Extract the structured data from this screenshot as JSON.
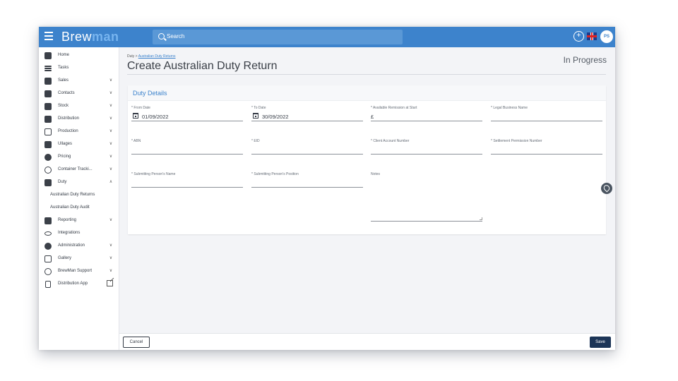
{
  "app": {
    "logo_part1": "Brew",
    "logo_part2": "man",
    "search_placeholder": "Search",
    "avatar_initials": "PS",
    "colors": {
      "topbar": "#3d83cc",
      "accent": "#3d83cc",
      "save": "#1c3557"
    }
  },
  "sidebar": {
    "items": [
      {
        "label": "Home",
        "icon": "home-icon"
      },
      {
        "label": "Tasks",
        "icon": "list-icon"
      },
      {
        "label": "Sales",
        "icon": "basket-icon",
        "chevron": "down"
      },
      {
        "label": "Contacts",
        "icon": "contacts-icon",
        "chevron": "down"
      },
      {
        "label": "Stock",
        "icon": "funnel-icon",
        "chevron": "down"
      },
      {
        "label": "Distribution",
        "icon": "truck-icon",
        "chevron": "down"
      },
      {
        "label": "Production",
        "icon": "production-icon",
        "chevron": "down"
      },
      {
        "label": "Ullages",
        "icon": "bottle-icon",
        "chevron": "down"
      },
      {
        "label": "Pricing",
        "icon": "pricing-icon",
        "chevron": "down"
      },
      {
        "label": "Container Tracki...",
        "icon": "target-icon",
        "chevron": "down"
      },
      {
        "label": "Duty",
        "icon": "duty-icon",
        "chevron": "up"
      },
      {
        "label": "Australian Duty Returns",
        "sub": true
      },
      {
        "label": "Australian Duty Audit",
        "sub": true
      },
      {
        "label": "Reporting",
        "icon": "report-icon",
        "chevron": "down"
      },
      {
        "label": "Integrations",
        "icon": "link-icon"
      },
      {
        "label": "Administration",
        "icon": "gear-icon",
        "chevron": "down"
      },
      {
        "label": "Gallery",
        "icon": "gallery-icon",
        "chevron": "down"
      },
      {
        "label": "BrewMan Support",
        "icon": "support-icon",
        "chevron": "down"
      },
      {
        "label": "Distribution App",
        "icon": "phone-icon",
        "external": true
      }
    ]
  },
  "main": {
    "breadcrumb_root": "Duty",
    "breadcrumb_sep": " > ",
    "breadcrumb_link": "Australian Duty Returns",
    "title": "Create Australian Duty Return",
    "status": "In Progress",
    "card_title": "Duty Details",
    "fields": {
      "from_date": {
        "label": "* From Date",
        "value": "01/09/2022"
      },
      "to_date": {
        "label": "* To Date",
        "value": "30/09/2022"
      },
      "remission": {
        "label": "* Available Remission at Start",
        "value": "£"
      },
      "legal_name": {
        "label": "* Legal Business Name",
        "value": ""
      },
      "abn": {
        "label": "* ABN",
        "value": ""
      },
      "eid": {
        "label": "* EID",
        "value": ""
      },
      "client_account": {
        "label": "* Client Account Number",
        "value": ""
      },
      "settlement": {
        "label": "* Settlement Permission Number",
        "value": ""
      },
      "person_name": {
        "label": "* Submitting Person's Name",
        "value": ""
      },
      "person_position": {
        "label": "* Submitting Person's Position",
        "value": ""
      },
      "notes": {
        "label": "Notes",
        "value": ""
      }
    }
  },
  "footer": {
    "cancel_label": "Cancel",
    "save_label": "Save"
  }
}
